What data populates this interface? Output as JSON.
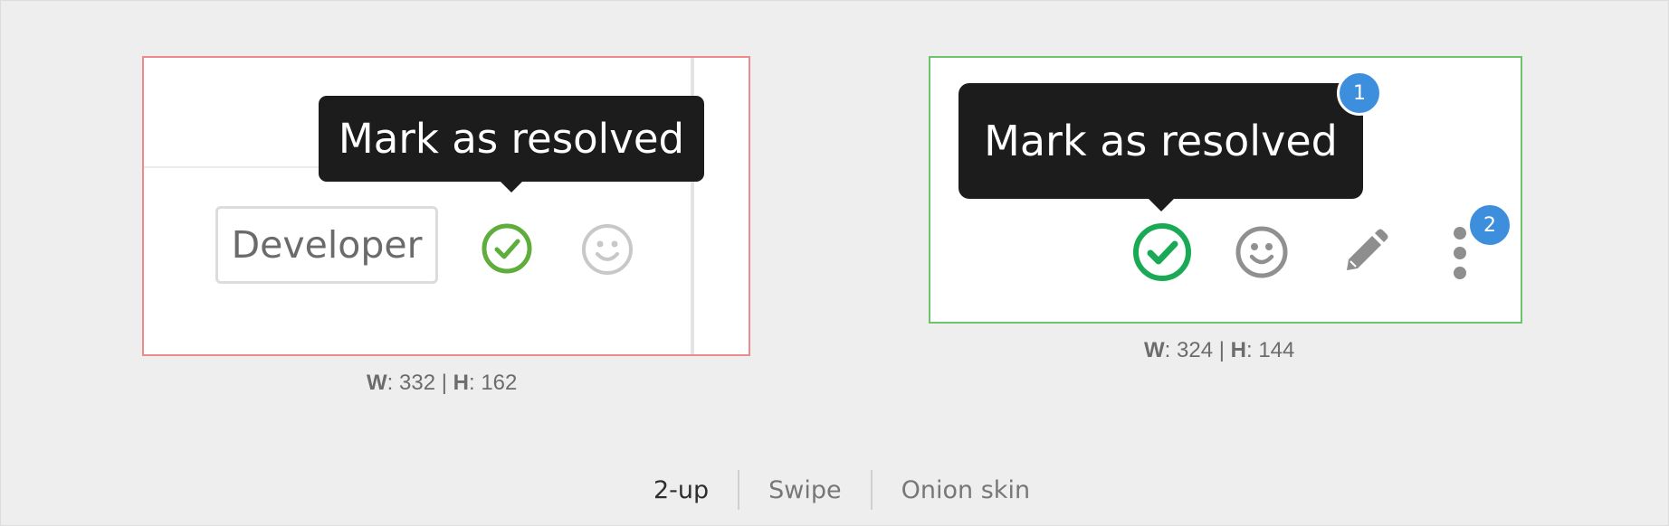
{
  "old_image": {
    "tooltip": "Mark as resolved",
    "role_badge": "Developer",
    "dimensions": {
      "w_label": "W",
      "w_value": "332",
      "separator": "|",
      "h_label": "H",
      "h_value": "162"
    }
  },
  "new_image": {
    "tooltip": "Mark as resolved",
    "markers": [
      "1",
      "2"
    ],
    "dimensions": {
      "w_label": "W",
      "w_value": "324",
      "separator": "|",
      "h_label": "H",
      "h_value": "144"
    }
  },
  "view_modes": {
    "tabs": [
      "2-up",
      "Swipe",
      "Onion skin"
    ],
    "active": "2-up"
  },
  "icons": {
    "old_image": [
      "resolve-check-icon",
      "emoji-icon"
    ],
    "new_image": [
      "resolve-check-icon",
      "emoji-icon",
      "pencil-icon",
      "more-actions-icon"
    ]
  },
  "colors": {
    "removed_border": "#ef8a8a",
    "added_border": "#6cc46c",
    "resolved_green": "#1aaa55",
    "marker_blue": "#3d8fde",
    "tooltip_bg": "#1c1c1c"
  }
}
